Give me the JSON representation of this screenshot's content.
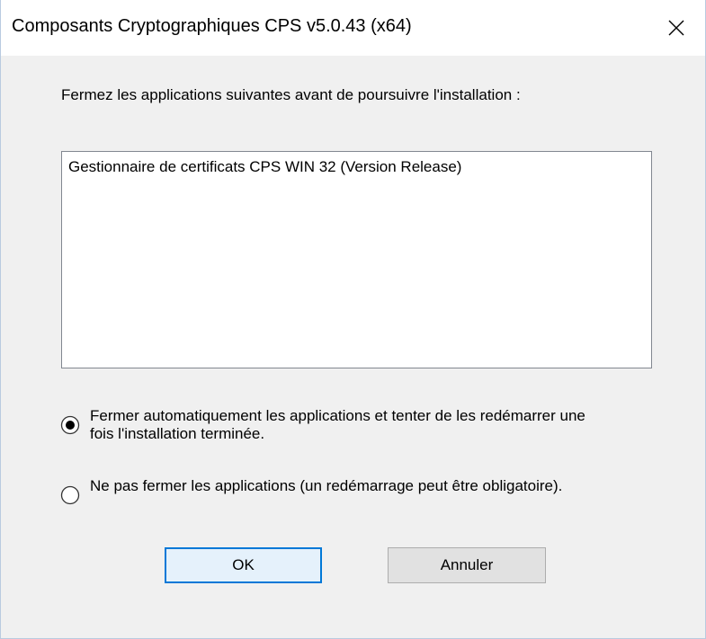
{
  "window": {
    "title": "Composants Cryptographiques CPS v5.0.43 (x64)",
    "close_icon": "close-icon"
  },
  "dialog": {
    "instruction": "Fermez les applications suivantes avant de poursuivre l'installation :",
    "applications": [
      "Gestionnaire de certificats CPS WIN 32 (Version Release)"
    ],
    "options": [
      {
        "label": "Fermer automatiquement les applications et tenter de les redémarrer une fois l'installation terminée.",
        "selected": true
      },
      {
        "label": "Ne pas fermer les applications (un redémarrage peut être obligatoire).",
        "selected": false
      }
    ],
    "ok_label": "OK",
    "cancel_label": "Annuler"
  },
  "colors": {
    "accent": "#0078d7",
    "window_bg": "#f0f0f0",
    "list_bg": "#ffffff"
  }
}
